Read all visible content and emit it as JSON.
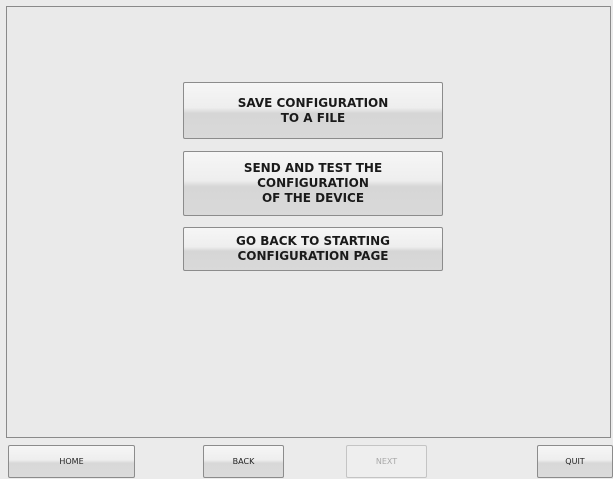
{
  "actions": {
    "save": {
      "lines": [
        "SAVE CONFIGURATION",
        "TO A FILE"
      ]
    },
    "send": {
      "lines": [
        "SEND AND TEST THE",
        "CONFIGURATION",
        "OF THE DEVICE"
      ]
    },
    "back_to_start": {
      "lines": [
        "GO BACK TO STARTING",
        "CONFIGURATION PAGE"
      ]
    }
  },
  "nav": {
    "home": "HOME",
    "back": "BACK",
    "next": "NEXT",
    "next_enabled": false,
    "quit": "QUIT"
  }
}
